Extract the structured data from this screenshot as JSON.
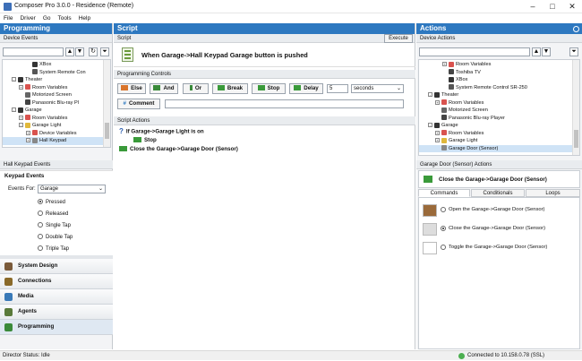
{
  "window": {
    "title": "Composer Pro 3.0.0 - Residence (Remote)"
  },
  "menu": [
    "File",
    "Driver",
    "Go",
    "Tools",
    "Help"
  ],
  "left": {
    "panel_title": "Programming",
    "device_events_label": "Device Events",
    "tree": [
      {
        "label": "XBox",
        "indent": 3,
        "icon": "xbox-icon",
        "color": "#333"
      },
      {
        "label": "System Remote Con",
        "indent": 3,
        "icon": "remote-icon",
        "color": "#555"
      },
      {
        "label": "Theater",
        "indent": 1,
        "icon": "room-icon",
        "color": "#333",
        "exp": "-"
      },
      {
        "label": "Room Variables",
        "indent": 2,
        "icon": "variables-icon",
        "color": "#d9534f",
        "exp": "+"
      },
      {
        "label": "Motorized Screen",
        "indent": 2,
        "icon": "screen-icon",
        "color": "#666"
      },
      {
        "label": "Panasonic Blu-ray Pl",
        "indent": 2,
        "icon": "bluray-icon",
        "color": "#444"
      },
      {
        "label": "Garage",
        "indent": 1,
        "icon": "room-icon",
        "color": "#333",
        "exp": "-"
      },
      {
        "label": "Room Variables",
        "indent": 2,
        "icon": "variables-icon",
        "color": "#d9534f",
        "exp": "+"
      },
      {
        "label": "Garage Light",
        "indent": 2,
        "icon": "light-icon",
        "color": "#e0b83b",
        "exp": "-"
      },
      {
        "label": "Device Variables",
        "indent": 3,
        "icon": "variables-icon",
        "color": "#d9534f",
        "exp": "+"
      },
      {
        "label": "Hall Keypad",
        "indent": 3,
        "icon": "keypad-icon",
        "color": "#888",
        "selected": true,
        "exp": "+"
      }
    ],
    "events_header": "Hall Keypad Events",
    "events_title": "Keypad Events",
    "events_for_label": "Events For:",
    "events_for_value": "Garage",
    "events": [
      {
        "label": "Pressed",
        "selected": true
      },
      {
        "label": "Released",
        "selected": false
      },
      {
        "label": "Single Tap",
        "selected": false
      },
      {
        "label": "Double Tap",
        "selected": false
      },
      {
        "label": "Triple Tap",
        "selected": false
      }
    ],
    "nav": [
      {
        "label": "System Design",
        "color": "#7a5a3a"
      },
      {
        "label": "Connections",
        "color": "#8a6a2a"
      },
      {
        "label": "Media",
        "color": "#3a7ab8"
      },
      {
        "label": "Agents",
        "color": "#5a7a3a"
      },
      {
        "label": "Programming",
        "color": "#3a8a3a",
        "active": true
      }
    ]
  },
  "script": {
    "panel_title": "Script",
    "script_label": "Script",
    "execute_label": "Execute",
    "event_title": "When Garage->Hall Keypad Garage button is pushed",
    "controls_label": "Programming Controls",
    "controls": [
      "Else",
      "And",
      "Or",
      "Break",
      "Stop",
      "Delay"
    ],
    "delay_value": "5",
    "delay_unit": "seconds",
    "comment_label": "Comment",
    "actions_label": "Script Actions",
    "actions": [
      {
        "text": "If Garage->Garage Light is on",
        "kind": "if"
      },
      {
        "text": "Stop",
        "kind": "stop"
      },
      {
        "text": "Close the Garage->Garage Door (Sensor)",
        "kind": "cmd"
      }
    ]
  },
  "actions": {
    "panel_title": "Actions",
    "device_actions_label": "Device Actions",
    "tree": [
      {
        "label": "Room Variables",
        "indent": 3,
        "icon": "variables-icon",
        "color": "#d9534f",
        "exp": "+"
      },
      {
        "label": "Toshiba TV",
        "indent": 3,
        "icon": "tv-icon",
        "color": "#444"
      },
      {
        "label": "XBox",
        "indent": 3,
        "icon": "xbox-icon",
        "color": "#333"
      },
      {
        "label": "System Remote Control SR-250",
        "indent": 3,
        "icon": "remote-icon",
        "color": "#555"
      },
      {
        "label": "Theater",
        "indent": 1,
        "icon": "room-icon",
        "color": "#333",
        "exp": "-"
      },
      {
        "label": "Room Variables",
        "indent": 2,
        "icon": "variables-icon",
        "color": "#d9534f",
        "exp": "+"
      },
      {
        "label": "Motorized Screen",
        "indent": 2,
        "icon": "screen-icon",
        "color": "#666"
      },
      {
        "label": "Panasonic Blu-ray Player",
        "indent": 2,
        "icon": "bluray-icon",
        "color": "#444"
      },
      {
        "label": "Garage",
        "indent": 1,
        "icon": "room-icon",
        "color": "#333",
        "exp": "-"
      },
      {
        "label": "Room Variables",
        "indent": 2,
        "icon": "variables-icon",
        "color": "#d9534f",
        "exp": "+"
      },
      {
        "label": "Garage Light",
        "indent": 2,
        "icon": "light-icon",
        "color": "#e0b83b",
        "exp": "+"
      },
      {
        "label": "Garage Door (Sensor)",
        "indent": 2,
        "icon": "door-icon",
        "color": "#888",
        "selected": true
      }
    ],
    "door_header": "Garage Door (Sensor) Actions",
    "door_title": "Close the Garage->Garage Door (Sensor)",
    "tabs": [
      "Commands",
      "Conditionals",
      "Loops"
    ],
    "commands": [
      {
        "label": "Open the Garage->Garage Door (Sensor)",
        "selected": false
      },
      {
        "label": "Close the Garage->Garage Door (Sensor)",
        "selected": true
      },
      {
        "label": "Toggle the Garage->Garage Door (Sensor)",
        "selected": false
      }
    ]
  },
  "status": {
    "left": "Director Status: Idle",
    "right": "Connected to 10.158.0.78 (SSL)"
  }
}
